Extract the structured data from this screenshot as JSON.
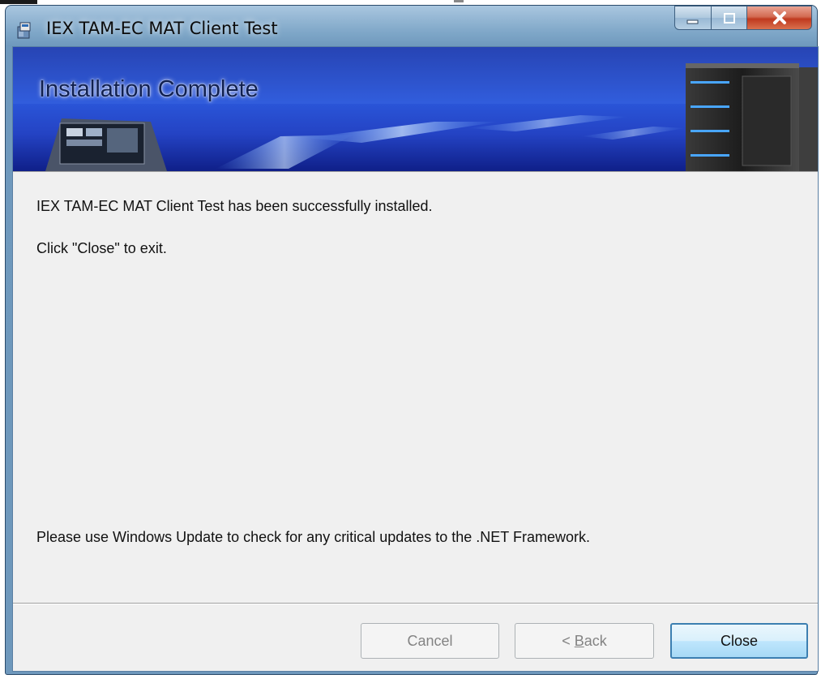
{
  "window": {
    "title": "IEX TAM-EC MAT Client Test",
    "icons": {
      "app": "installer-package-icon",
      "minimize": "minimize-icon",
      "maximize": "maximize-icon",
      "close": "close-icon"
    }
  },
  "banner": {
    "title": "Installation Complete",
    "art": "laptop-and-server-banner-graphic"
  },
  "body": {
    "line1": "IEX TAM-EC MAT Client Test has been successfully installed.",
    "line2": "Click \"Close\" to exit.",
    "line3": "Please use Windows Update to check for any critical updates to the .NET Framework."
  },
  "buttons": {
    "cancel": {
      "label": "Cancel",
      "enabled": false
    },
    "back": {
      "label": "< Back",
      "mnemonic": "B",
      "enabled": false
    },
    "close": {
      "label": "Close",
      "enabled": true
    }
  },
  "colors": {
    "banner_blue": "#2a55d8",
    "frame_blue": "#6e98bc",
    "close_red": "#c0391f",
    "primary_button_border": "#3c7fb1"
  }
}
